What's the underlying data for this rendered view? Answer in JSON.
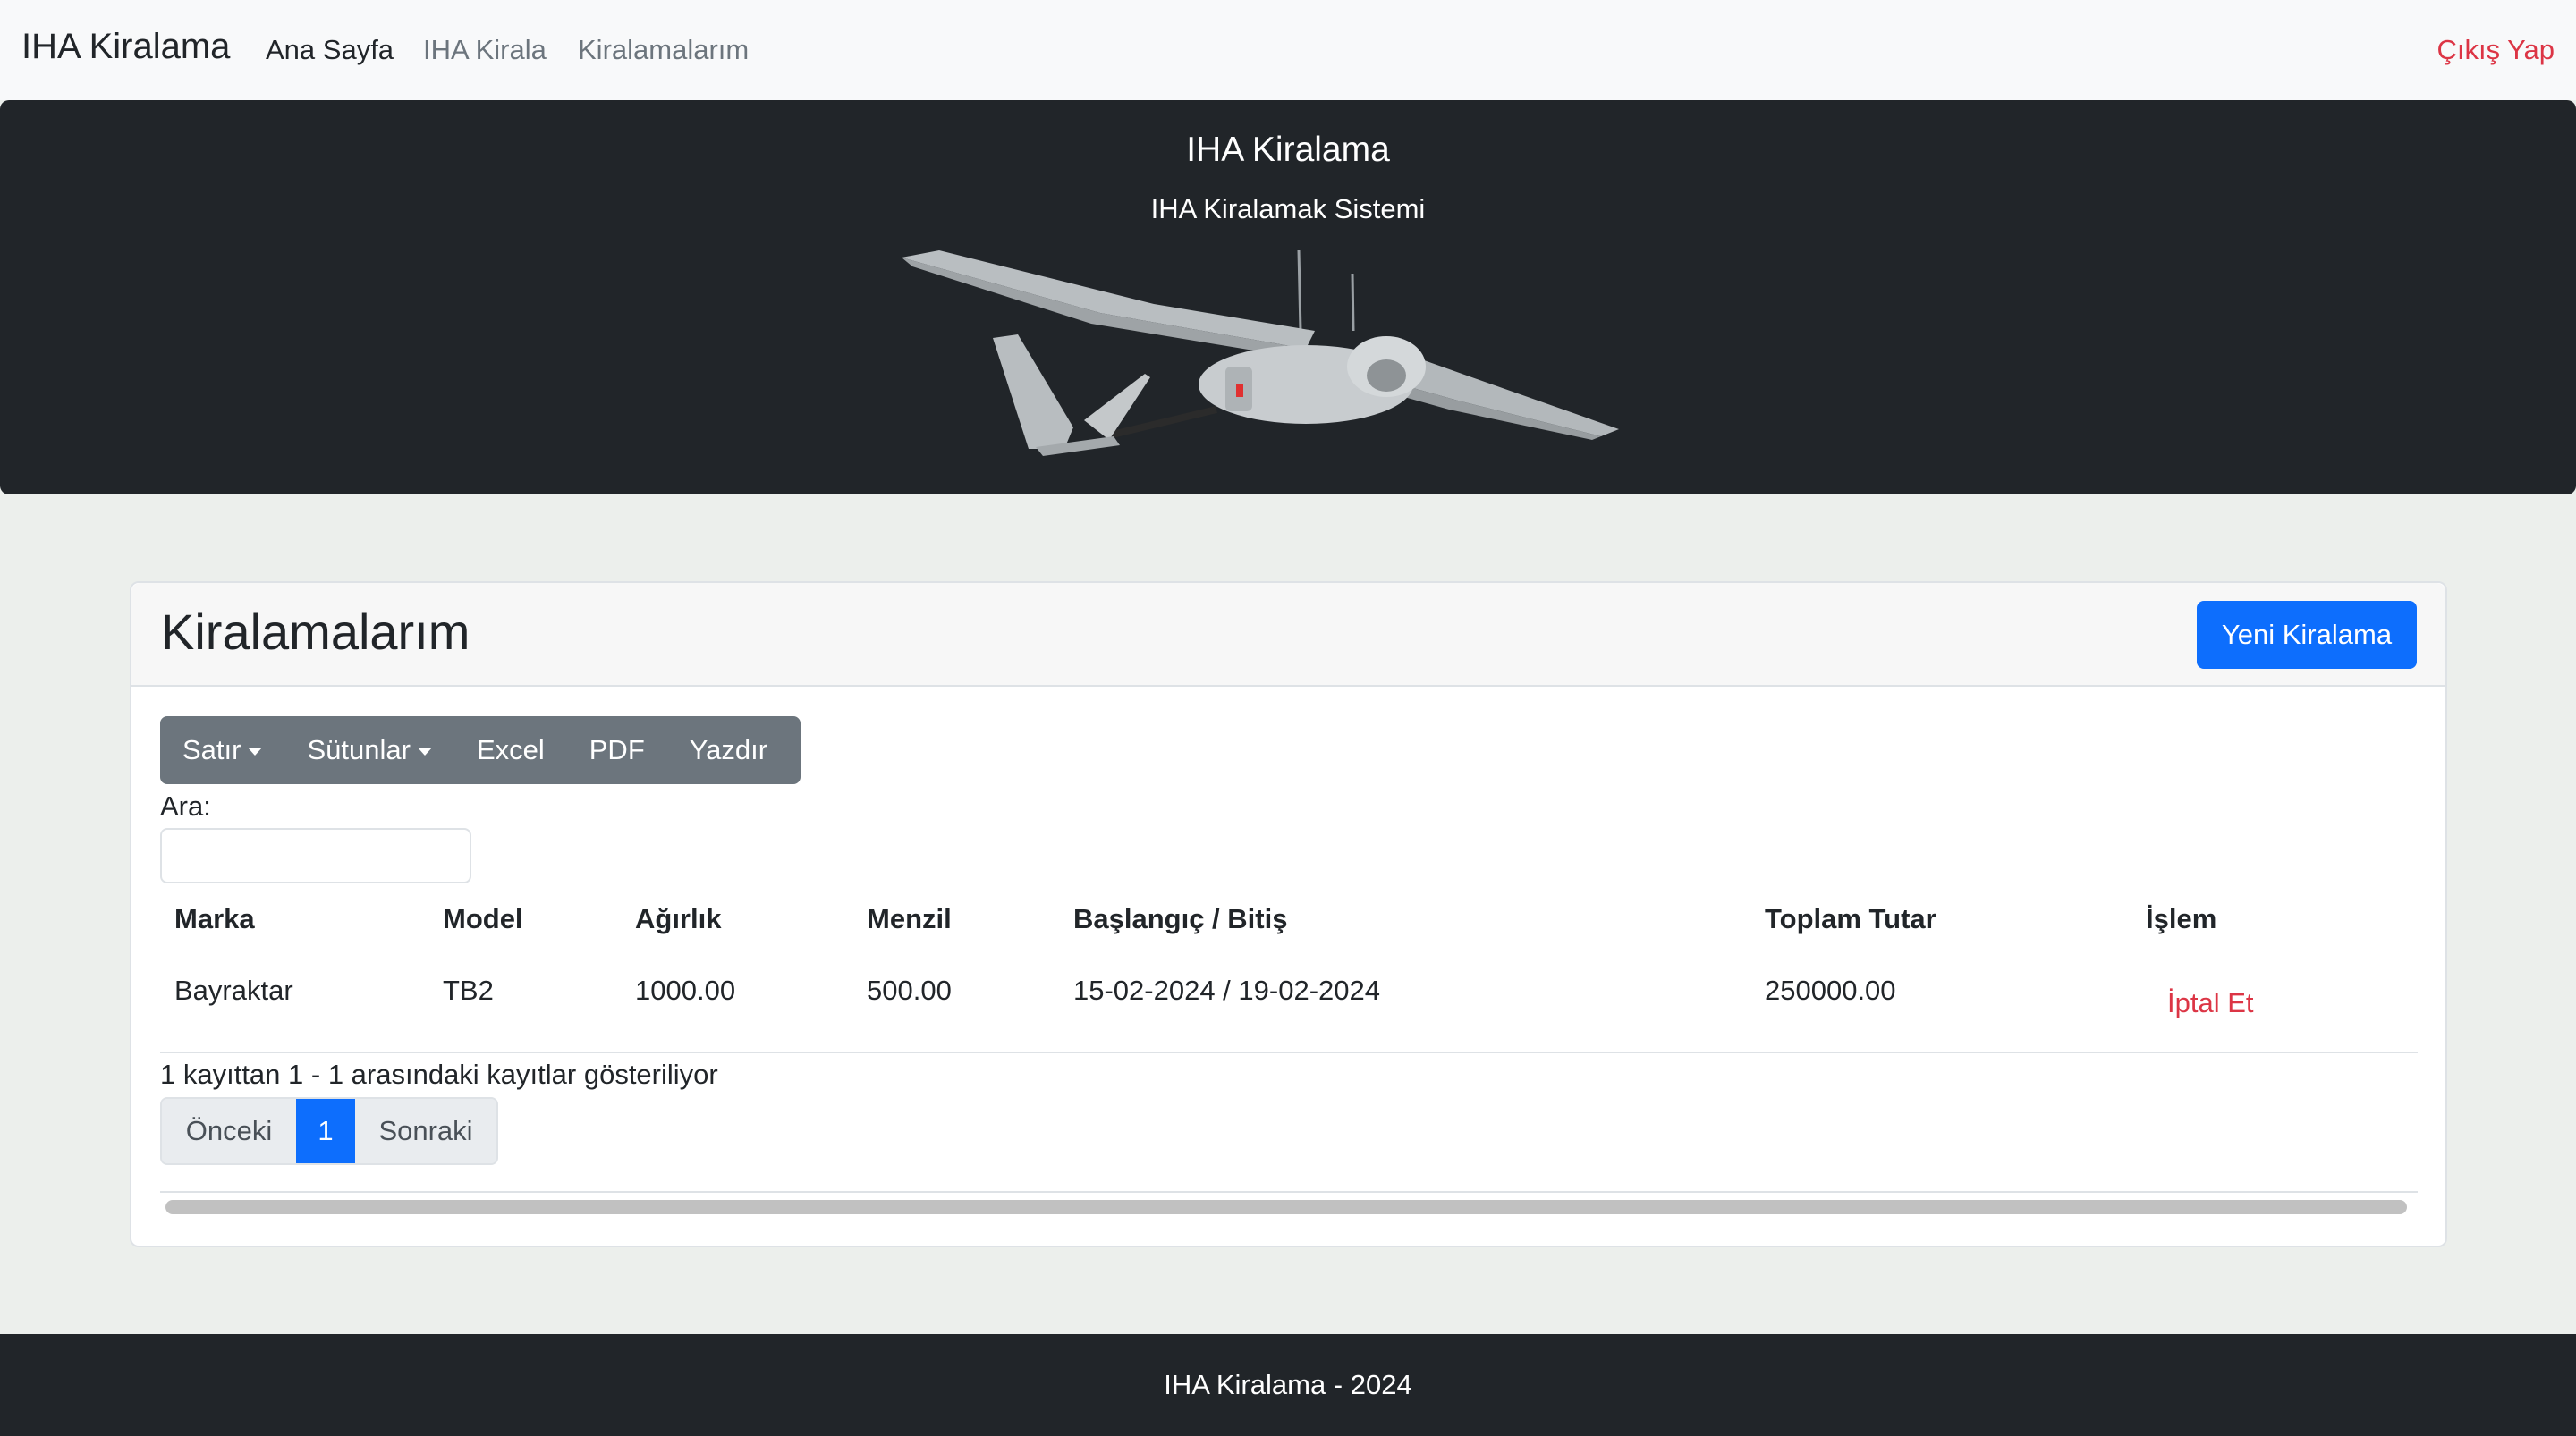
{
  "navbar": {
    "brand": "IHA Kiralama",
    "links": [
      "Ana Sayfa",
      "IHA Kirala",
      "Kiralamalarım"
    ],
    "logout": "Çıkış Yap"
  },
  "hero": {
    "title": "IHA Kiralama",
    "subtitle": "IHA Kiralamak Sistemi",
    "image": "drone-image"
  },
  "card": {
    "title": "Kiralamalarım",
    "new_button": "Yeni Kiralama"
  },
  "toolbar": {
    "buttons": [
      "Satır",
      "Sütunlar",
      "Excel",
      "PDF",
      "Yazdır"
    ]
  },
  "search": {
    "label": "Ara:",
    "value": ""
  },
  "table": {
    "headers": [
      "Marka",
      "Model",
      "Ağırlık",
      "Menzil",
      "Başlangıç / Bitiş",
      "Toplam Tutar",
      "İşlem"
    ],
    "rows": [
      {
        "marka": "Bayraktar",
        "model": "TB2",
        "agirlik": "1000.00",
        "menzil": "500.00",
        "tarih": "15-02-2024 / 19-02-2024",
        "toplam": "250000.00",
        "islem": "İptal Et"
      }
    ]
  },
  "info": "1 kayıttan 1 - 1 arasındaki kayıtlar gösteriliyor",
  "pagination": {
    "prev": "Önceki",
    "current": "1",
    "next": "Sonraki"
  },
  "footer": "IHA Kiralama - 2024",
  "colors": {
    "primary": "#0d6efd",
    "danger": "#dc3545",
    "dark": "#212529",
    "secondary": "#6c757d"
  }
}
